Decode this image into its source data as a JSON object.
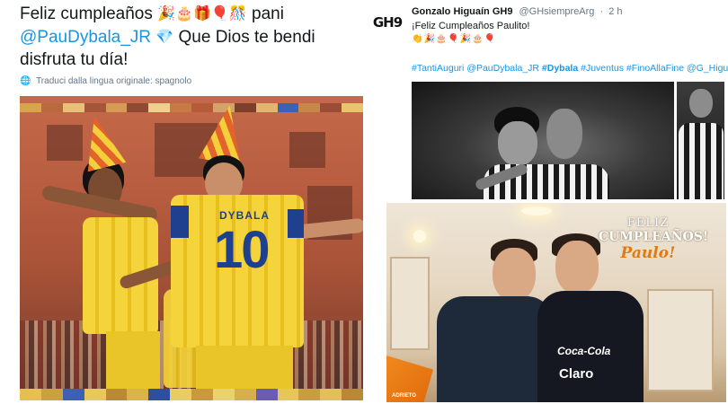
{
  "left_tweet": {
    "line1_text": "Feliz cumpleaños",
    "line1_emojis": "🎉🎂🎁🎈🎊",
    "line1_suffix": "pani",
    "line2_mention": "@PauDybala_JR",
    "line2_emoji": "💎",
    "line2_text": "Que Dios te bendi",
    "line3_text": "disfruta tu día!",
    "translation_note": "Traduci dalla lingua originale: spagnolo",
    "globe_icon": "🌐",
    "photo": {
      "jersey_name": "DYBALA",
      "jersey_number": "10",
      "colors": {
        "jersey_yellow": "#f5d33a",
        "jersey_blue": "#1f3f8f",
        "stadium_brick": "#b85d40"
      }
    }
  },
  "right_tweet": {
    "avatar_text": "GH9",
    "author_name": "Gonzalo Higuaín GH9",
    "handle": "@GHsiempreArg",
    "separator": "·",
    "time_ago": "2 h",
    "text": "¡Feliz Cumpleaños Paulito!",
    "emoji_row": "👏🎉🎂🎈🎉🎂🎈",
    "hashtags": {
      "part1": "#TantiAuguri @PauDybala_JR ",
      "bold": "#Dybala",
      "part2": " #Juventus #FinoAllaFine @G_Higu"
    },
    "photo_overlay": {
      "line1": "FELIZ",
      "line2": "CUMPLEAÑOS!",
      "line3": "Paulo!"
    },
    "shirt_sponsor_1": "Coca-Cola",
    "shirt_sponsor_2": "Claro",
    "logo_badge_text": "ADRIETO",
    "colors": {
      "link": "#1b95e0",
      "overlay_orange": "#e27a14"
    }
  }
}
